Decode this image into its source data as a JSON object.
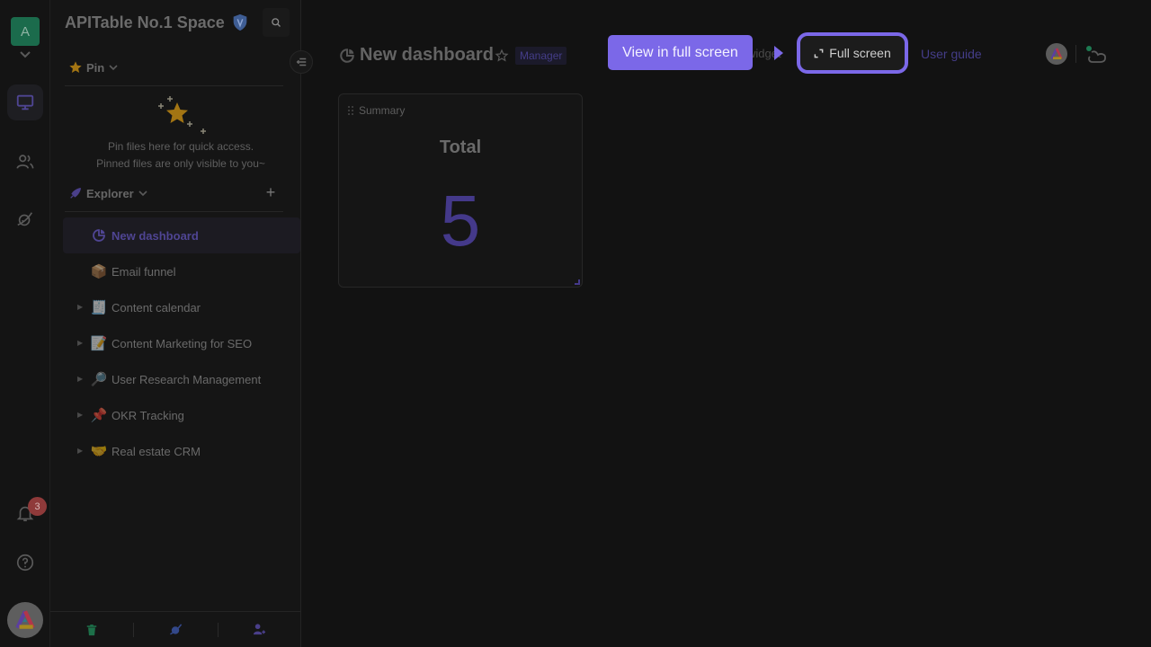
{
  "rail": {
    "space_initial": "A",
    "notification_count": "3",
    "items": [
      {
        "name": "workbench",
        "active": true
      },
      {
        "name": "members",
        "active": false
      },
      {
        "name": "templates",
        "active": false
      }
    ]
  },
  "sidebar": {
    "space_name": "APITable No.1 Space",
    "pin": {
      "label": "Pin",
      "empty_line1": "Pin files here for quick access.",
      "empty_line2": "Pinned files are only visible to you~"
    },
    "explorer": {
      "label": "Explorer",
      "add_label": "+"
    },
    "nodes": [
      {
        "label": "New dashboard",
        "icon": "dashboard-icon",
        "glyph": "",
        "expandable": false,
        "active": true
      },
      {
        "label": "Email funnel",
        "icon": "package-emoji",
        "glyph": "📦",
        "expandable": false,
        "active": false
      },
      {
        "label": "Content calendar",
        "icon": "receipt-emoji",
        "glyph": "🧾",
        "expandable": true,
        "active": false
      },
      {
        "label": "Content Marketing for SEO",
        "icon": "memo-emoji",
        "glyph": "📝",
        "expandable": true,
        "active": false
      },
      {
        "label": "User Research Management",
        "icon": "magnifier-emoji",
        "glyph": "🔎",
        "expandable": true,
        "active": false
      },
      {
        "label": "OKR Tracking",
        "icon": "pushpin-emoji",
        "glyph": "📌",
        "expandable": true,
        "active": false
      },
      {
        "label": "Real estate CRM",
        "icon": "handshake-emoji",
        "glyph": "🤝",
        "expandable": true,
        "active": false
      }
    ]
  },
  "header": {
    "title": "New dashboard",
    "role_tag": "Manager",
    "tooltip": "View in full screen",
    "widget_ghost": "widget",
    "full_screen": "Full screen",
    "user_guide": "User guide"
  },
  "widget": {
    "name": "Summary",
    "title": "Total",
    "value": "5"
  },
  "colors": {
    "accent": "#7b68e8",
    "accent_dim": "#443d88",
    "space_avatar": "#1b6b4c",
    "badge": "#8f3a3a",
    "background": "#121212"
  }
}
